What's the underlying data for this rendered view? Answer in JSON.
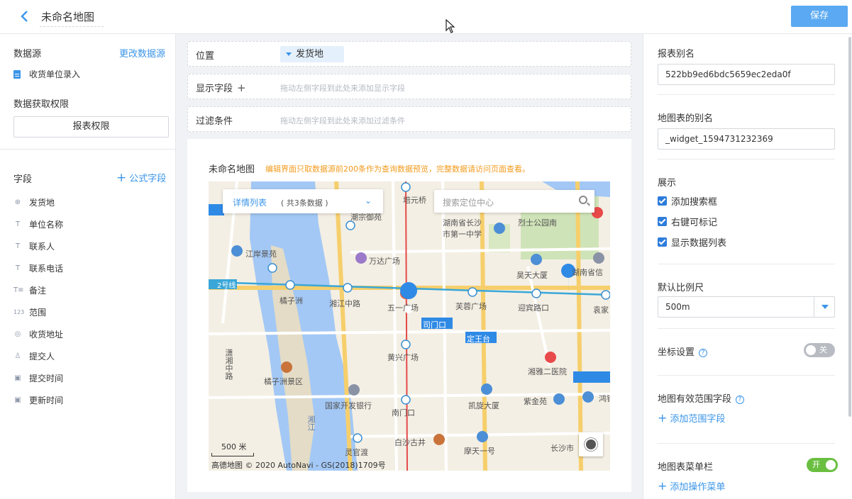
{
  "header": {
    "title": "未命名地图",
    "save_label": "保存"
  },
  "left": {
    "datasource_label": "数据源",
    "change_datasource": "更改数据源",
    "datasource_item": "收货单位录入",
    "permission_label": "数据获取权限",
    "permission_button": "报表权限",
    "fields_label": "字段",
    "formula_field": "公式字段",
    "fields": [
      {
        "icon": "location-icon",
        "glyph": "⊕",
        "label": "发货地"
      },
      {
        "icon": "text-icon",
        "glyph": "T",
        "label": "单位名称"
      },
      {
        "icon": "text-icon",
        "glyph": "T",
        "label": "联系人"
      },
      {
        "icon": "text-icon",
        "glyph": "T",
        "label": "联系电话"
      },
      {
        "icon": "multiline-text-icon",
        "glyph": "T≡",
        "label": "备注"
      },
      {
        "icon": "number-icon",
        "glyph": "123",
        "label": "范围"
      },
      {
        "icon": "pin-icon",
        "glyph": "◎",
        "label": "收货地址"
      },
      {
        "icon": "user-icon",
        "glyph": "♙",
        "label": "提交人"
      },
      {
        "icon": "calendar-icon",
        "glyph": "▣",
        "label": "提交时间"
      },
      {
        "icon": "calendar-icon",
        "glyph": "▣",
        "label": "更新时间"
      }
    ]
  },
  "center": {
    "position_label": "位置",
    "position_chip": "发货地",
    "display_label": "显示字段",
    "display_hint": "拖动左侧字段到此处来添加显示字段",
    "filter_label": "过滤条件",
    "filter_hint": "拖动左侧字段到此处来添加过滤条件",
    "chart_title": "未命名地图",
    "chart_note": "编辑界面只取数据源前200条作为查询数据预览，完整数据请访问页面查看。"
  },
  "map": {
    "list_title": "详情列表",
    "list_count": "( 共3条数据 )",
    "search_placeholder": "搜索定位中心",
    "scale": "500 米",
    "copyright": "高德地图 © 2020 AutoNavi - GS(2018)1709号",
    "labels": {
      "l1": "培元桥",
      "l2": "湖南省长沙",
      "l3": "市第一中学",
      "l4": "烈士公园南",
      "l5": "江岸景苑",
      "l6": "万达广场",
      "l7": "昊天大厦",
      "l8": "湖南省信",
      "l9": "橘子洲",
      "l10": "湘江中路",
      "l11": "五一广场",
      "l12": "芙蓉广场",
      "l13": "迎宾路口",
      "l14": "袁家",
      "l15": "司门口",
      "l16": "定王台",
      "l17": "黄兴广场",
      "l18": "湘雅二医院",
      "l19": "橘子洲景区",
      "l20": "国家开发银行",
      "l21": "凯旋大厦",
      "l22": "紫金苑",
      "l23": "南门口",
      "l24": "白沙古井",
      "l25": "灵官渡",
      "l26": "摩天一号",
      "l27": "长沙市",
      "l28": "潮宗御苑",
      "l29": "2号线",
      "l30": "湘江",
      "l31": "潇湘中路",
      "l32": "鸿铭"
    }
  },
  "right": {
    "alias_label": "报表别名",
    "alias_value": "522bb9ed6bdc5659ec2eda0f",
    "map_alias_label": "地图表的别名",
    "map_alias_value": "_widget_1594731232369",
    "display_label": "展示",
    "checkboxes": [
      "添加搜索框",
      "右键可标记",
      "显示数据列表"
    ],
    "scale_label": "默认比例尺",
    "scale_value": "500m",
    "coord_label": "坐标设置",
    "coord_toggle": "关",
    "range_label": "地图有效范围字段",
    "range_link": "添加范围字段",
    "menu_label": "地图表菜单栏",
    "menu_toggle": "开",
    "menu_link": "添加操作菜单"
  },
  "colors": {
    "accent": "#3b95e8",
    "save": "#5aa9f2",
    "note": "#f29b1e",
    "toggle_on": "#6abf40"
  }
}
